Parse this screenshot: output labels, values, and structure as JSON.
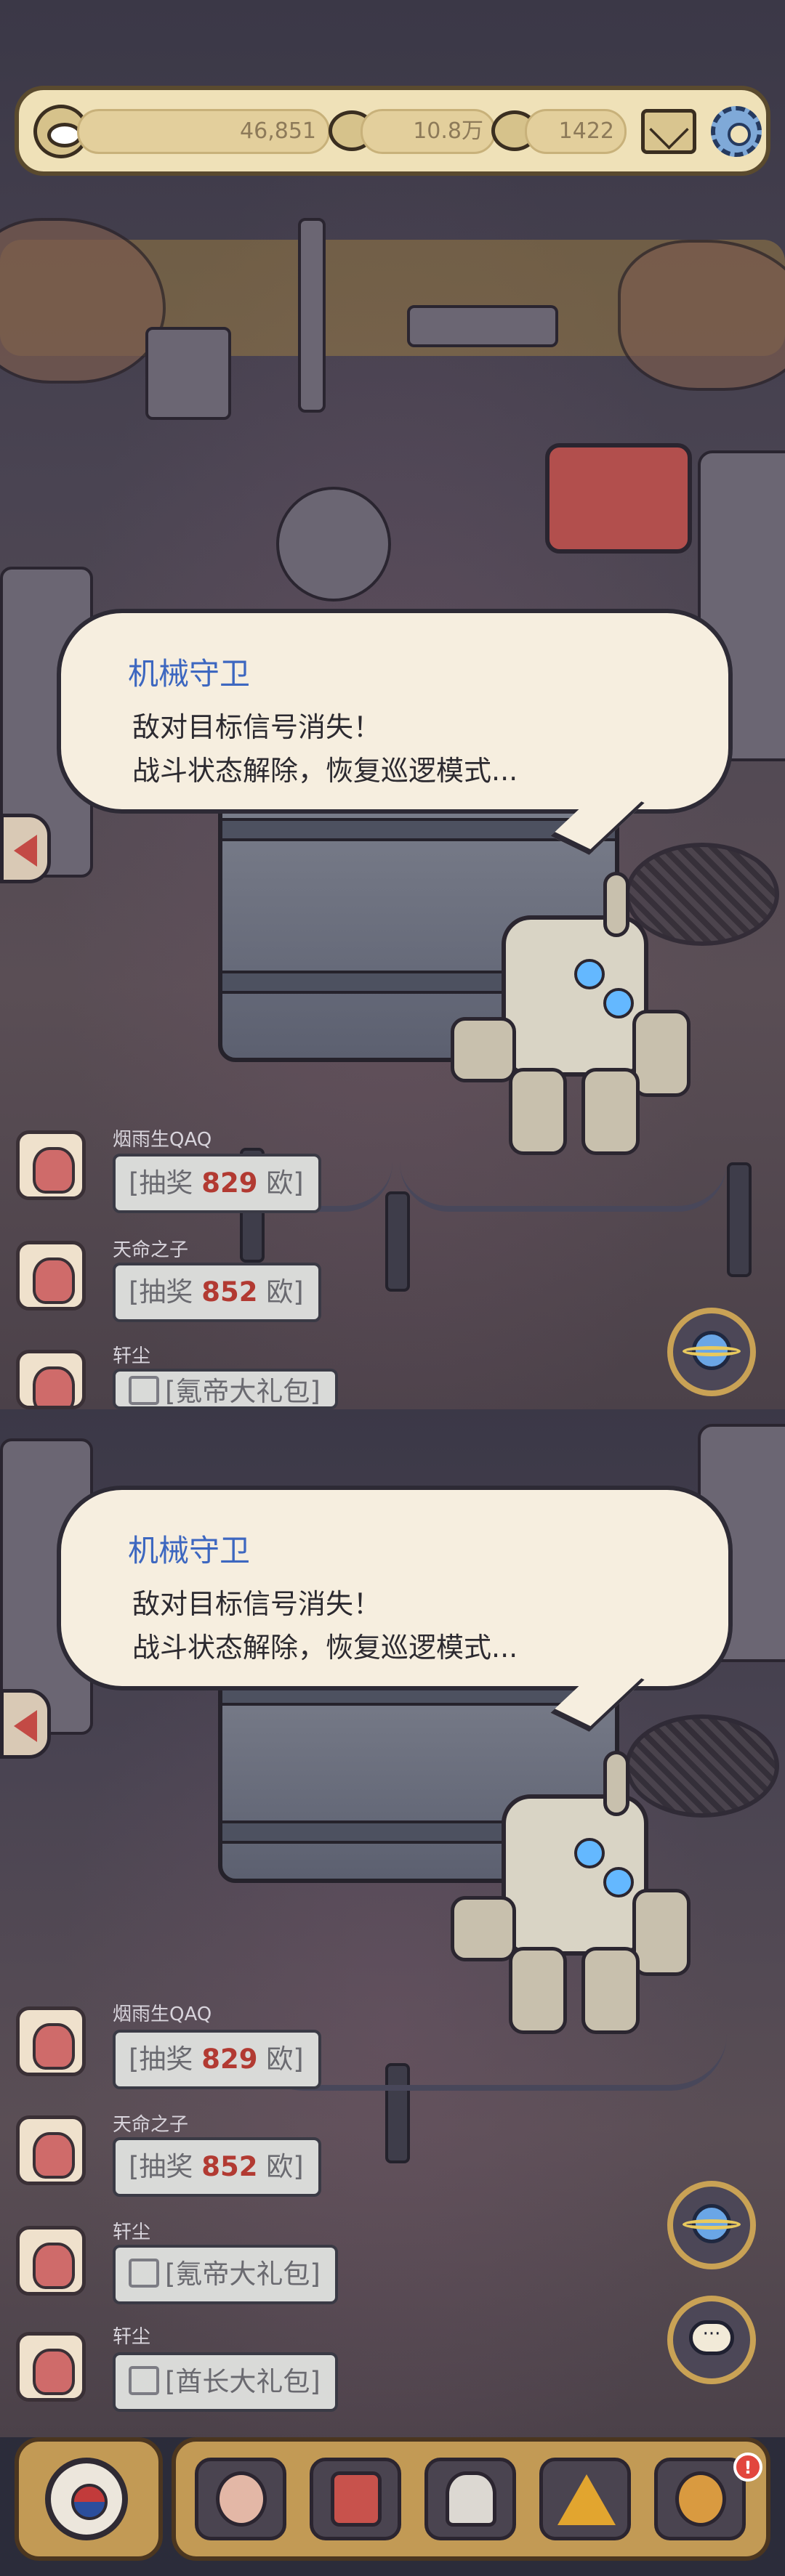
{
  "topbar": {
    "eye_count": "46,851",
    "bubble_count": "10.8万",
    "comment_count": "1422",
    "icons": [
      "eye-icon",
      "speech-bubble-icon",
      "comment-icon",
      "mail-icon",
      "gear-icon"
    ]
  },
  "dialogue": {
    "speaker": "机械守卫",
    "line1": "敌对目标信号消失！",
    "line2": "战斗状态解除，恢复巡逻模式..."
  },
  "feed_top": [
    {
      "user": "烟雨生QAQ",
      "prefix": "[抽奖 ",
      "amount": "829",
      "suffix": " 欧]"
    },
    {
      "user": "天命之子",
      "prefix": "[抽奖 ",
      "amount": "852",
      "suffix": " 欧]"
    },
    {
      "user": "轩尘",
      "text": "[氪帝大礼包]"
    }
  ],
  "feed_bottom": [
    {
      "user": "烟雨生QAQ",
      "prefix": "[抽奖 ",
      "amount": "829",
      "suffix": " 欧]"
    },
    {
      "user": "天命之子",
      "prefix": "[抽奖 ",
      "amount": "852",
      "suffix": " 欧]"
    },
    {
      "user": "轩尘",
      "text": "[氪帝大礼包]"
    },
    {
      "user": "轩尘",
      "text": "[酋长大礼包]"
    }
  ],
  "dock": {
    "buttons": [
      "snail-icon",
      "backpack-icon",
      "statue-icon",
      "pyramid-icon",
      "key-icon"
    ],
    "notification": "!"
  },
  "colors": {
    "speaker_name": "#3d67c0",
    "lottery_amount": "#b23a32",
    "bar_bg": "#efe1b8",
    "dock_bg": "#c29a55"
  }
}
